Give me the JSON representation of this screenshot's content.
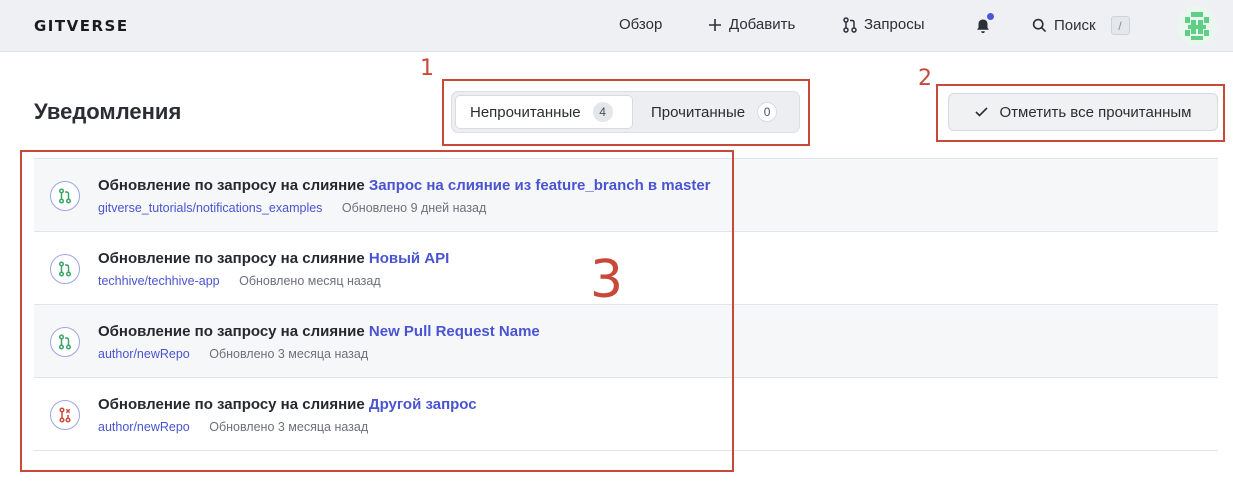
{
  "header": {
    "logo": "GITVERSE",
    "nav": {
      "overview": "Обзор",
      "add": "Добавить",
      "requests": "Запросы",
      "search": "Поиск",
      "search_shortcut": "/"
    }
  },
  "page": {
    "title": "Уведомления"
  },
  "tabs": [
    {
      "label": "Непрочитанные",
      "count": "4"
    },
    {
      "label": "Прочитанные",
      "count": "0"
    }
  ],
  "mark_all_label": "Отметить все прочитанным",
  "notifications": [
    {
      "prefix": "Обновление по запросу на слияние",
      "link": "Запрос на слияние из feature_branch в master",
      "repo": "gitverse_tutorials/notifications_examples",
      "updated": "Обновлено 9 дней назад",
      "state": "open"
    },
    {
      "prefix": "Обновление по запросу на слияние",
      "link": "Новый API",
      "repo": "techhive/techhive-app",
      "updated": "Обновлено месяц назад",
      "state": "open"
    },
    {
      "prefix": "Обновление по запросу на слияние",
      "link": "New Pull Request Name",
      "repo": "author/newRepo",
      "updated": "Обновлено 3 месяца назад",
      "state": "open"
    },
    {
      "prefix": "Обновление по запросу на слияние",
      "link": "Другой запрос",
      "repo": "author/newRepo",
      "updated": "Обновлено 3 месяца назад",
      "state": "closed"
    }
  ],
  "annotations": [
    "1",
    "2",
    "3"
  ],
  "colors": {
    "accent": "#4a54d1",
    "annotation": "#c8493a",
    "pr_open": "#3aa56a",
    "pr_closed": "#c8493a"
  }
}
